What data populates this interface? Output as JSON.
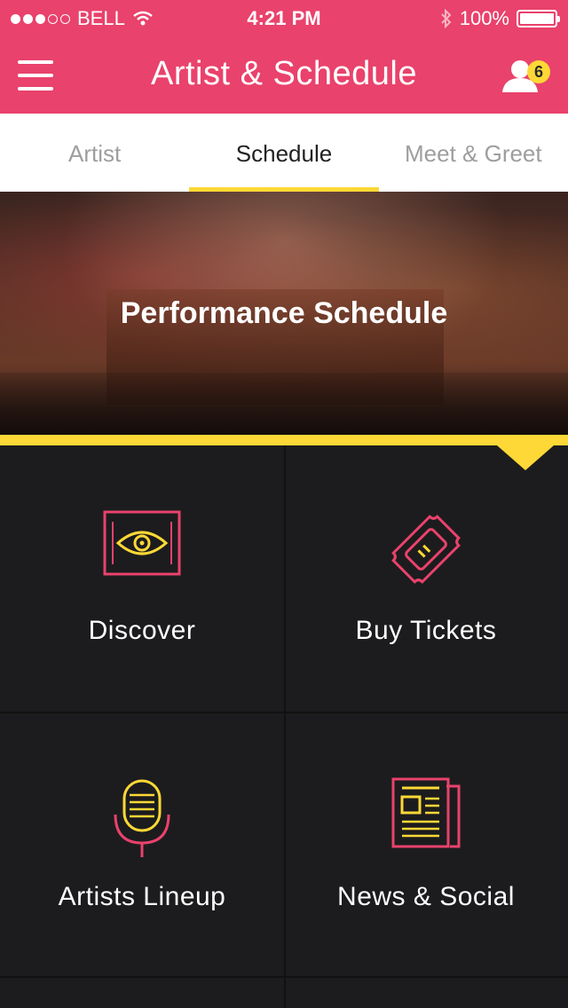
{
  "status_bar": {
    "carrier": "BELL",
    "time": "4:21 PM",
    "battery": "100%",
    "signal_filled": 3,
    "signal_total": 5
  },
  "nav": {
    "title": "Artist & Schedule",
    "notification_count": "6"
  },
  "tabs": [
    {
      "label": "Artist",
      "active": false
    },
    {
      "label": "Schedule",
      "active": true
    },
    {
      "label": "Meet & Greet",
      "active": false
    }
  ],
  "hero": {
    "title": "Performance Schedule"
  },
  "grid": [
    {
      "label": "Discover",
      "icon": "eye-icon"
    },
    {
      "label": "Buy Tickets",
      "icon": "ticket-icon"
    },
    {
      "label": "Artists Lineup",
      "icon": "microphone-icon"
    },
    {
      "label": "News & Social",
      "icon": "newspaper-icon"
    }
  ],
  "colors": {
    "brand": "#e9426c",
    "accent": "#fdd836",
    "background": "#1c1c1e"
  }
}
